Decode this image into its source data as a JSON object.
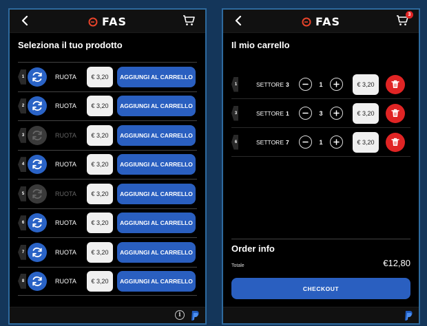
{
  "left_screen": {
    "header": {
      "logo_text": "FAS",
      "back_icon": "chevron-left-icon",
      "cart_icon": "cart-icon"
    },
    "title": "Seleziona il tuo prodotto",
    "products": [
      {
        "num": "1",
        "name": "RUOTA",
        "price": "€ 3,20",
        "button": "AGGIUNGI AL CARRELLO",
        "enabled": true
      },
      {
        "num": "2",
        "name": "RUOTA",
        "price": "€ 3,20",
        "button": "AGGIUNGI AL CARRELLO",
        "enabled": true
      },
      {
        "num": "3",
        "name": "RUOTA",
        "price": "€ 3,20",
        "button": "AGGIUNGI AL CARRELLO",
        "enabled": false
      },
      {
        "num": "4",
        "name": "RUOTA",
        "price": "€ 3,20",
        "button": "AGGIUNGI AL CARRELLO",
        "enabled": true
      },
      {
        "num": "5",
        "name": "RUOTA",
        "price": "€ 3,20",
        "button": "AGGIUNGI AL CARRELLO",
        "enabled": false
      },
      {
        "num": "6",
        "name": "RUOTA",
        "price": "€ 3,20",
        "button": "AGGIUNGI AL CARRELLO",
        "enabled": true
      },
      {
        "num": "7",
        "name": "RUOTA",
        "price": "€ 3,20",
        "button": "AGGIUNGI AL CARRELLO",
        "enabled": true
      },
      {
        "num": "8",
        "name": "RUOTA",
        "price": "€ 3,20",
        "button": "AGGIUNGI AL CARRELLO",
        "enabled": true
      }
    ],
    "footer": {
      "info_icon": "info-icon",
      "payment_icon": "paypal-icon"
    }
  },
  "right_screen": {
    "header": {
      "logo_text": "FAS",
      "back_icon": "chevron-left-icon",
      "cart_icon": "cart-icon",
      "cart_badge": "3"
    },
    "title": "Il mio carrello",
    "items": [
      {
        "num": "1",
        "label": "SETTORE",
        "sector": "3",
        "qty": "1",
        "price": "€ 3,20"
      },
      {
        "num": "3",
        "label": "SETTORE",
        "sector": "1",
        "qty": "3",
        "price": "€ 3,20"
      },
      {
        "num": "6",
        "label": "SETTORE",
        "sector": "7",
        "qty": "1",
        "price": "€ 3,20"
      }
    ],
    "order_info": {
      "title": "Order info",
      "total_label": "Totale",
      "total_value": "€12,80"
    },
    "checkout_label": "CHECKOUT",
    "footer": {
      "payment_icon": "paypal-icon"
    }
  },
  "colors": {
    "background": "#14365a",
    "panel_border": "#2e6a9e",
    "primary_blue": "#2a5fc0",
    "danger_red": "#e02424",
    "logo_red": "#e8432a"
  }
}
